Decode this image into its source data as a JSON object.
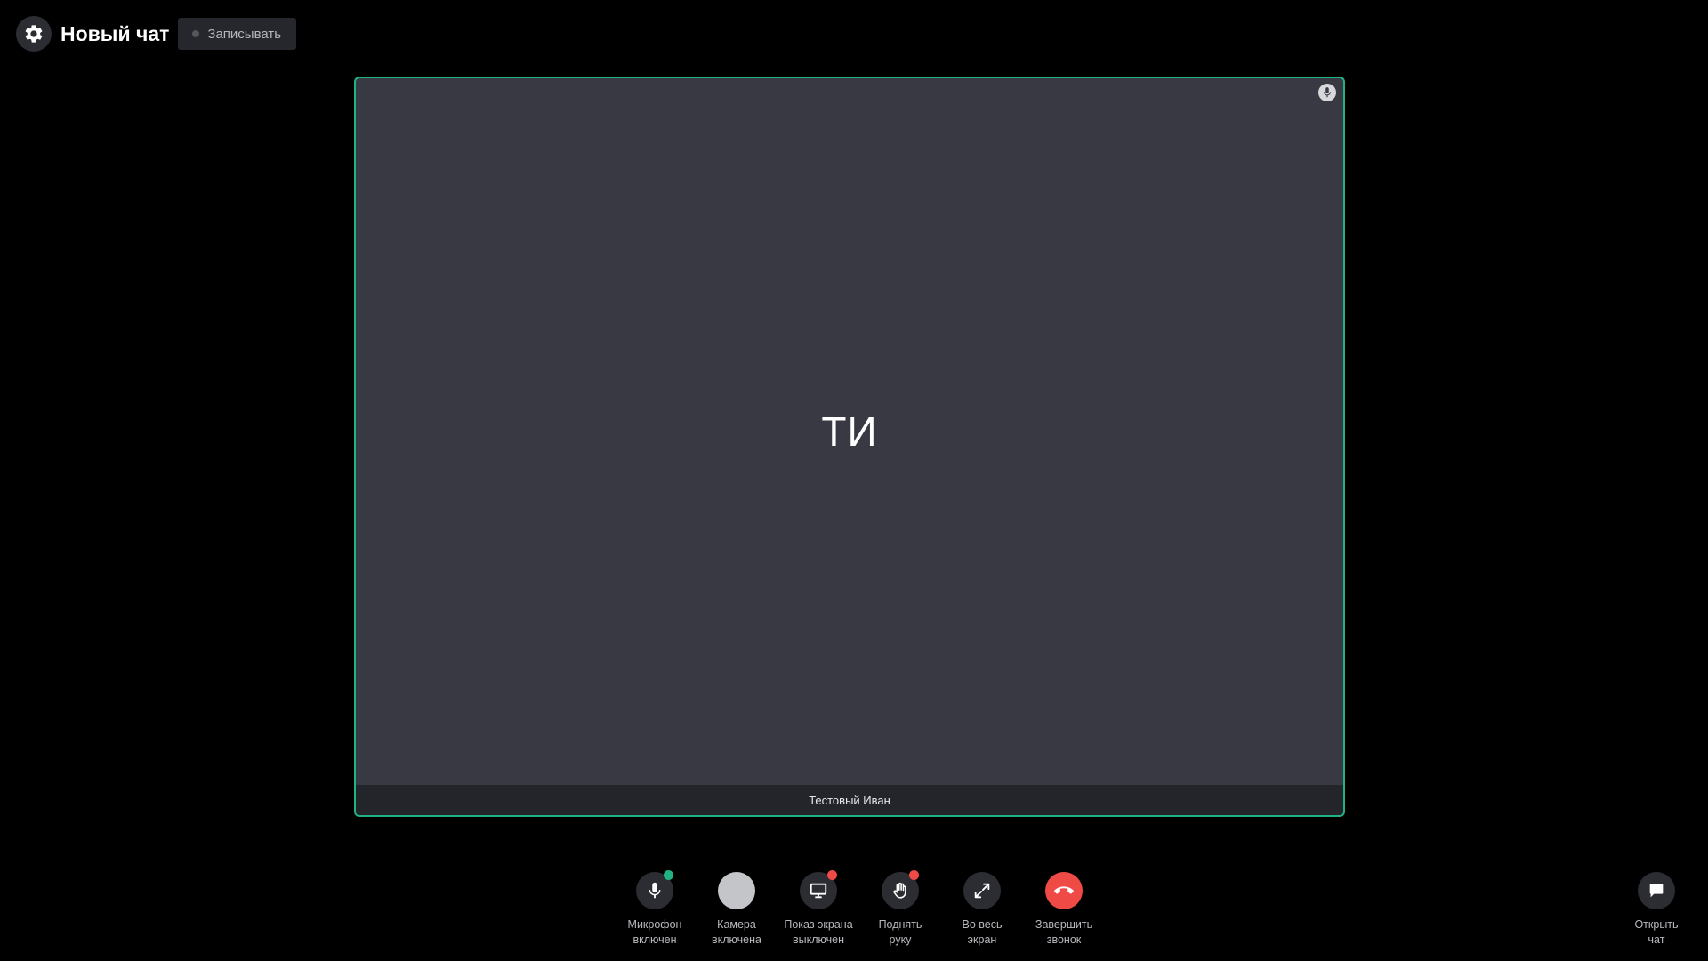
{
  "header": {
    "settings_icon": "gear-icon",
    "title": "Новый чат",
    "record_label": "Записывать"
  },
  "tile": {
    "initials": "ТИ",
    "name": "Тестовый Иван",
    "border_color": "#1fb383",
    "mic_icon": "microphone-icon"
  },
  "controls": {
    "mic": {
      "line1": "Микрофон",
      "line2": "включен",
      "icon": "microphone-icon",
      "indicator_color": "#1fb383"
    },
    "camera": {
      "line1": "Камера",
      "line2": "включена",
      "icon": "camera-icon"
    },
    "screen": {
      "line1": "Показ экрана",
      "line2": "выключен",
      "icon": "monitor-icon",
      "indicator_color": "#f04a46"
    },
    "hand": {
      "line1": "Поднять",
      "line2": "руку",
      "icon": "hand-icon",
      "indicator_color": "#f04a46"
    },
    "fullscreen": {
      "line1": "Во весь",
      "line2": "экран",
      "icon": "expand-icon"
    },
    "end_call": {
      "line1": "Завершить",
      "line2": "звонок",
      "icon": "phone-hangup-icon",
      "color": "#f04a46"
    }
  },
  "open_chat": {
    "line1": "Открыть",
    "line2": "чат",
    "icon": "chat-bubble-icon"
  }
}
